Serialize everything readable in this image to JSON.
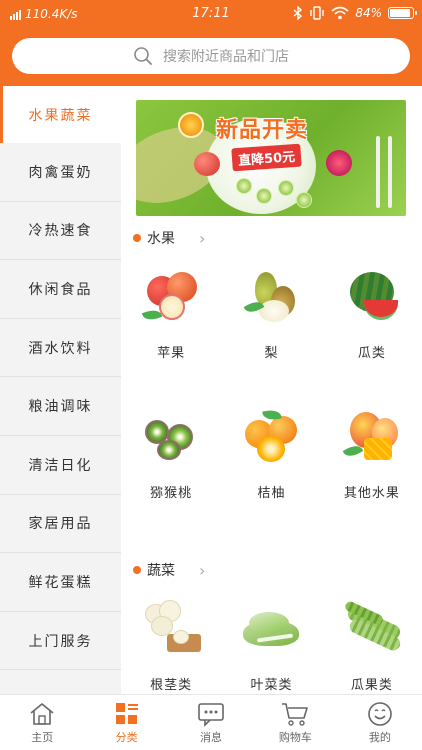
{
  "status_bar": {
    "network_speed": "110.4K/s",
    "time": "17:11",
    "battery": "84%",
    "battery_level": 0.84
  },
  "search": {
    "placeholder": "搜索附近商品和门店"
  },
  "sidebar": {
    "items": [
      {
        "label": "水果蔬菜",
        "active": true
      },
      {
        "label": "肉禽蛋奶",
        "active": false
      },
      {
        "label": "冷热速食",
        "active": false
      },
      {
        "label": "休闲食品",
        "active": false
      },
      {
        "label": "酒水饮料",
        "active": false
      },
      {
        "label": "粮油调味",
        "active": false
      },
      {
        "label": "清洁日化",
        "active": false
      },
      {
        "label": "家居用品",
        "active": false
      },
      {
        "label": "鲜花蛋糕",
        "active": false
      },
      {
        "label": "上门服务",
        "active": false
      }
    ]
  },
  "banner": {
    "title": "新品开卖",
    "subtitle": "直降50元"
  },
  "sections": [
    {
      "title": "水果",
      "items": [
        {
          "label": "苹果",
          "icon": "apple-icon"
        },
        {
          "label": "梨",
          "icon": "pear-icon"
        },
        {
          "label": "瓜类",
          "icon": "watermelon-icon"
        },
        {
          "label": "猕猴桃",
          "icon": "kiwi-icon"
        },
        {
          "label": "桔柚",
          "icon": "orange-icon"
        },
        {
          "label": "其他水果",
          "icon": "mango-icon"
        }
      ]
    },
    {
      "title": "蔬菜",
      "items": [
        {
          "label": "根茎类",
          "icon": "cauliflower-icon"
        },
        {
          "label": "叶菜类",
          "icon": "lettuce-icon"
        },
        {
          "label": "瓜果类",
          "icon": "bitter-gourd-icon"
        }
      ]
    }
  ],
  "bottom_nav": {
    "items": [
      {
        "label": "主页",
        "icon": "home-icon",
        "active": false
      },
      {
        "label": "分类",
        "icon": "category-icon",
        "active": true
      },
      {
        "label": "消息",
        "icon": "message-icon",
        "active": false
      },
      {
        "label": "购物车",
        "icon": "cart-icon",
        "active": false
      },
      {
        "label": "我的",
        "icon": "profile-icon",
        "active": false
      }
    ]
  },
  "colors": {
    "accent": "#f36f21",
    "sidebar_bg": "#f3f3f3"
  }
}
